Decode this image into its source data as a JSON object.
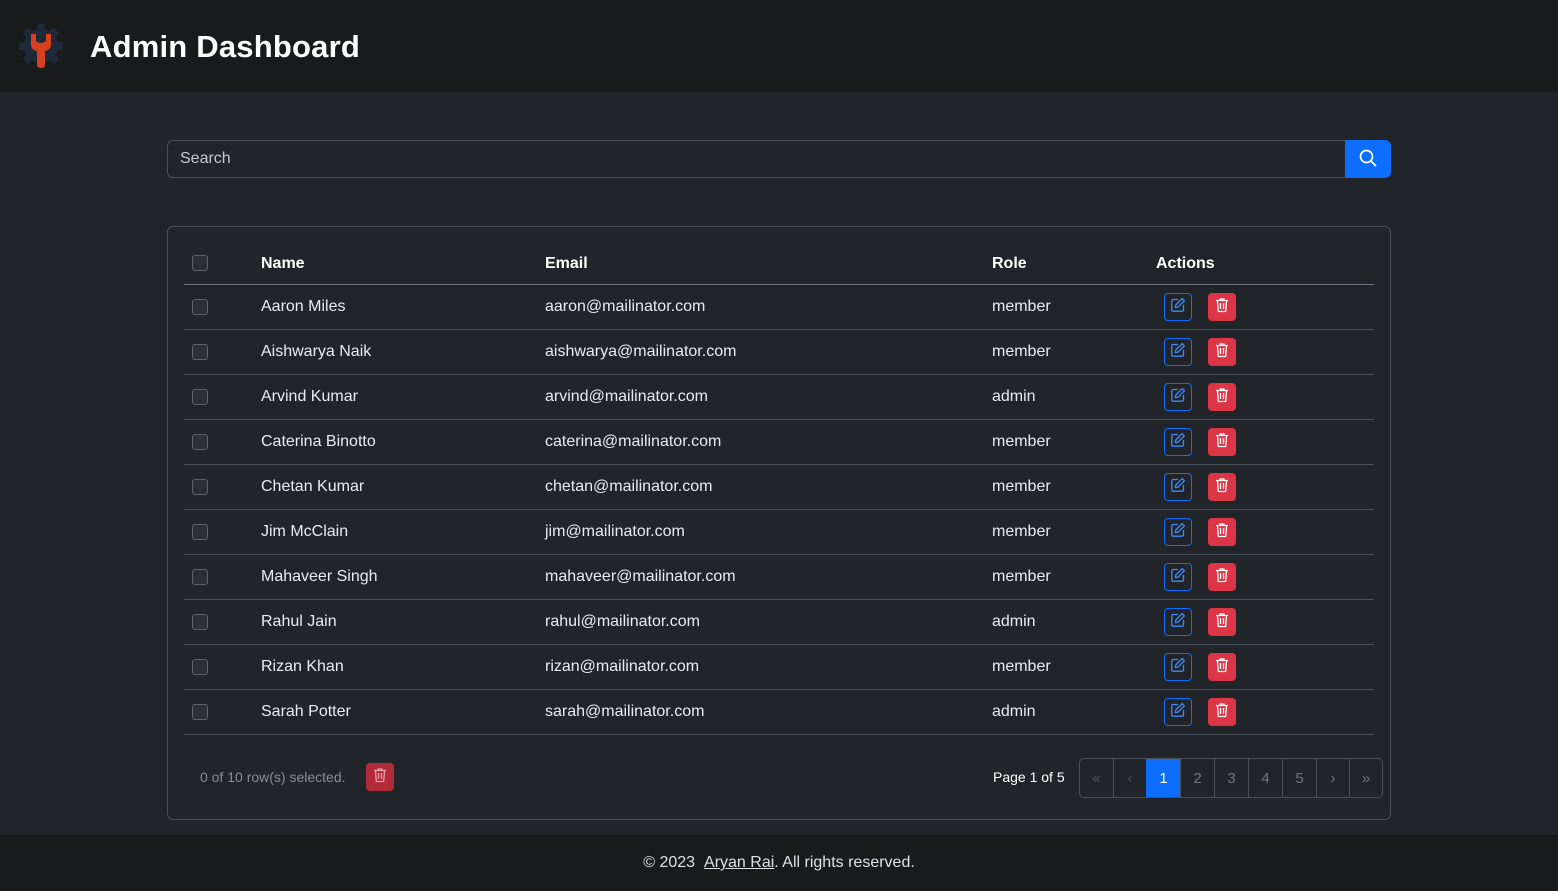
{
  "header": {
    "title": "Admin Dashboard",
    "logo_icon": "gear-wrench-icon",
    "colors": {
      "logo_gear": "#1f2a38",
      "logo_wrench": "#d9401f"
    }
  },
  "search": {
    "placeholder": "Search",
    "value": "",
    "button_icon": "search-icon",
    "button_color": "#0d6efd"
  },
  "table": {
    "columns": [
      "Name",
      "Email",
      "Role",
      "Actions"
    ],
    "rows": [
      {
        "name": "Aaron Miles",
        "email": "aaron@mailinator.com",
        "role": "member"
      },
      {
        "name": "Aishwarya Naik",
        "email": "aishwarya@mailinator.com",
        "role": "member"
      },
      {
        "name": "Arvind Kumar",
        "email": "arvind@mailinator.com",
        "role": "admin"
      },
      {
        "name": "Caterina Binotto",
        "email": "caterina@mailinator.com",
        "role": "member"
      },
      {
        "name": "Chetan Kumar",
        "email": "chetan@mailinator.com",
        "role": "member"
      },
      {
        "name": "Jim McClain",
        "email": "jim@mailinator.com",
        "role": "member"
      },
      {
        "name": "Mahaveer Singh",
        "email": "mahaveer@mailinator.com",
        "role": "member"
      },
      {
        "name": "Rahul Jain",
        "email": "rahul@mailinator.com",
        "role": "admin"
      },
      {
        "name": "Rizan Khan",
        "email": "rizan@mailinator.com",
        "role": "member"
      },
      {
        "name": "Sarah Potter",
        "email": "sarah@mailinator.com",
        "role": "admin"
      }
    ],
    "action_icons": {
      "edit": "edit-icon",
      "delete": "trash-icon"
    },
    "colors": {
      "edit": "#0d6efd",
      "delete": "#dc3545"
    }
  },
  "selection": {
    "text": "0 of 10 row(s) selected.",
    "bulk_delete_icon": "trash-icon"
  },
  "pagination": {
    "page_info": "Page 1 of 5",
    "first": "«",
    "prev": "‹",
    "pages": [
      "1",
      "2",
      "3",
      "4",
      "5"
    ],
    "current": "1",
    "next": "›",
    "last": "»"
  },
  "footer": {
    "prefix": "© 2023",
    "author": "Aryan Rai",
    "suffix": ". All rights reserved."
  }
}
